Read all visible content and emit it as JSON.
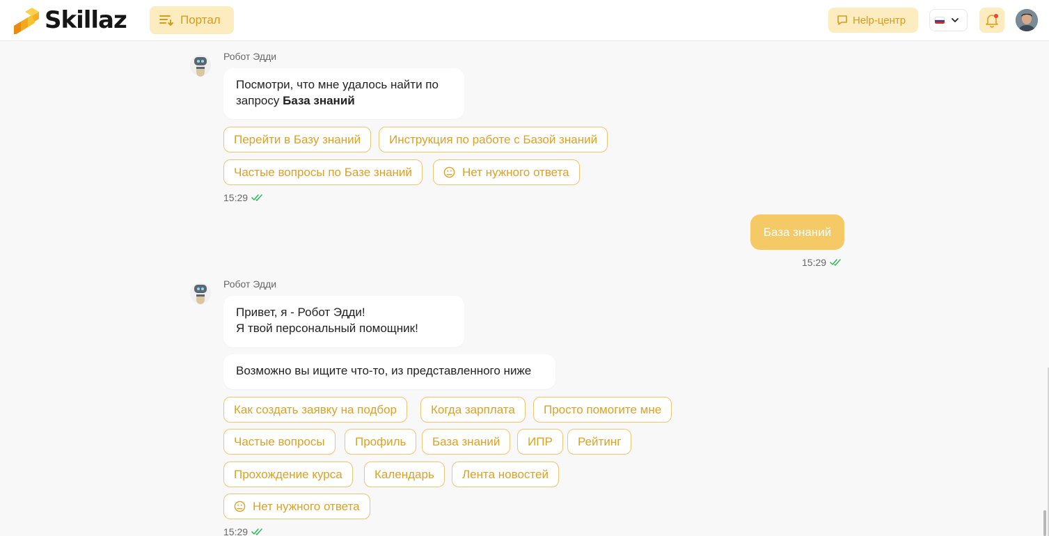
{
  "header": {
    "logo_text": "Skillaz",
    "portal_label": "Портал",
    "help_label": "Help-центр"
  },
  "colors": {
    "accent": "#f4c966",
    "accent_light": "#fdecc0",
    "chip_text": "#dba126",
    "check": "#2eb85c"
  },
  "chat": {
    "msg1": {
      "sender": "Робот Эдди",
      "text_before": "Посмотри, что мне удалось найти по запросу ",
      "text_bold": "База знаний",
      "chips": [
        "Перейти в Базу знаний",
        "Инструкция по работе с Базой знаний",
        "Частые вопросы по Базе знаний",
        "Нет нужного ответа"
      ],
      "time": "15:29"
    },
    "user_msg": {
      "text": "База знаний",
      "time": "15:29"
    },
    "msg2": {
      "sender": "Робот Эдди",
      "line1": "Привет, я - Робот Эдди!",
      "line2": "Я твой персональный помощник!",
      "text2": "Возможно вы ищите что-то, из представленного ниже",
      "chips": [
        "Как создать заявку на подбор",
        "Когда зарплата",
        "Просто помогите мне",
        "Частые вопросы",
        "Профиль",
        "База знаний",
        "ИПР",
        "Рейтинг",
        "Прохождение курса",
        "Календарь",
        "Лента новостей",
        "Нет нужного ответа"
      ],
      "time": "15:29"
    }
  }
}
